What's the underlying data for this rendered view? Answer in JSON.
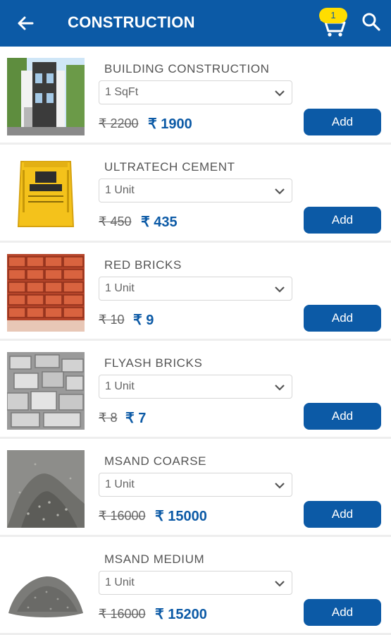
{
  "header": {
    "title": "CONSTRUCTION",
    "cart_count": "1",
    "bg_color": "#0c5aa6"
  },
  "products": [
    {
      "name": "BUILDING CONSTRUCTION",
      "unit": "1 SqFt",
      "old_price": "₹ 2200",
      "new_price": "₹ 1900",
      "add_label": "Add"
    },
    {
      "name": "ULTRATECH CEMENT",
      "unit": "1 Unit",
      "old_price": "₹ 450",
      "new_price": "₹ 435",
      "add_label": "Add"
    },
    {
      "name": "RED BRICKS",
      "unit": "1 Unit",
      "old_price": "₹ 10",
      "new_price": "₹ 9",
      "add_label": "Add"
    },
    {
      "name": "FLYASH BRICKS",
      "unit": "1 Unit",
      "old_price": "₹ 8",
      "new_price": "₹ 7",
      "add_label": "Add"
    },
    {
      "name": "MSAND COARSE",
      "unit": "1 Unit",
      "old_price": "₹ 16000",
      "new_price": "₹ 15000",
      "add_label": "Add"
    },
    {
      "name": "MSAND MEDIUM",
      "unit": "1 Unit",
      "old_price": "₹ 16000",
      "new_price": "₹ 15200",
      "add_label": "Add"
    }
  ]
}
